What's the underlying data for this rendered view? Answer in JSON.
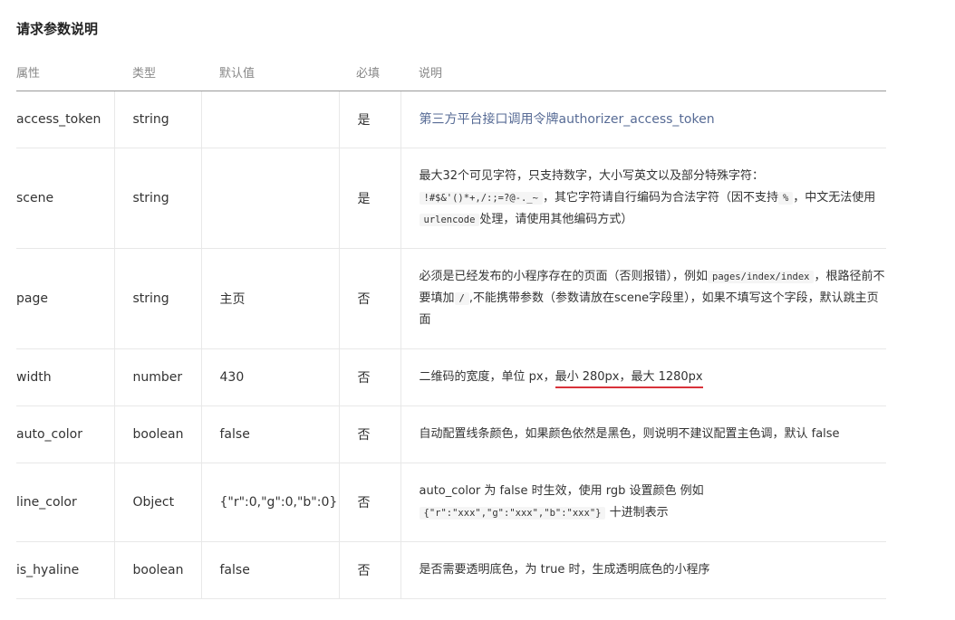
{
  "title": "请求参数说明",
  "columns": [
    "属性",
    "类型",
    "默认值",
    "必填",
    "说明"
  ],
  "rows": [
    {
      "name": "access_token",
      "type": "string",
      "default": "",
      "required": "是",
      "desc": "第三方平台接口调用令牌authorizer_access_token"
    },
    {
      "name": "scene",
      "type": "string",
      "default": "",
      "required": "是",
      "desc_1": "最大32个可见字符，只支持数字，大小写英文以及部分特殊字符：",
      "code_1": "!#$&'()*+,/:;=?@-._~",
      "desc_2": "，其它字符请自行编码为合法字符（因不支持",
      "code_2": "%",
      "desc_3": "，中文无法使用",
      "code_3": "urlencode",
      "desc_4": "处理，请使用其他编码方式）"
    },
    {
      "name": "page",
      "type": "string",
      "default": "主页",
      "required": "否",
      "desc_1": "必须是已经发布的小程序存在的页面（否则报错），例如",
      "code_1": "pages/index/index",
      "desc_2": "，根路径前不要填加",
      "code_2": "/",
      "desc_3": ",不能携带参数（参数请放在scene字段里），如果不填写这个字段，默认跳主页面"
    },
    {
      "name": "width",
      "type": "number",
      "default": "430",
      "required": "否",
      "desc_1": "二维码的宽度，单位 px，",
      "desc_hl": "最小 280px，最大 1280px"
    },
    {
      "name": "auto_color",
      "type": "boolean",
      "default": "false",
      "required": "否",
      "desc": "自动配置线条颜色，如果颜色依然是黑色，则说明不建议配置主色调，默认 false"
    },
    {
      "name": "line_color",
      "type": "Object",
      "default": "{\"r\":0,\"g\":0,\"b\":0}",
      "required": "否",
      "desc_1": "auto_color 为 false 时生效，使用 rgb 设置颜色 例如",
      "code_1": "{\"r\":\"xxx\",\"g\":\"xxx\",\"b\":\"xxx\"}",
      "desc_2": "十进制表示"
    },
    {
      "name": "is_hyaline",
      "type": "boolean",
      "default": "false",
      "required": "否",
      "desc": "是否需要透明底色，为 true 时，生成透明底色的小程序"
    }
  ]
}
